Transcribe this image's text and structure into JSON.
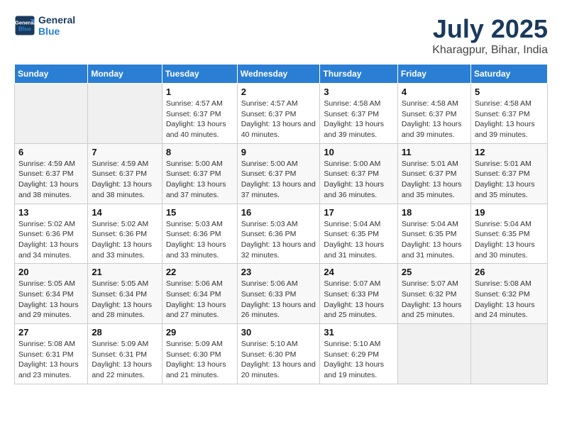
{
  "header": {
    "logo_line1": "General",
    "logo_line2": "Blue",
    "title": "July 2025",
    "subtitle": "Kharagpur, Bihar, India"
  },
  "days_of_week": [
    "Sunday",
    "Monday",
    "Tuesday",
    "Wednesday",
    "Thursday",
    "Friday",
    "Saturday"
  ],
  "weeks": [
    [
      {
        "day": "",
        "empty": true
      },
      {
        "day": "",
        "empty": true
      },
      {
        "day": "1",
        "sunrise": "4:57 AM",
        "sunset": "6:37 PM",
        "daylight": "13 hours and 40 minutes."
      },
      {
        "day": "2",
        "sunrise": "4:57 AM",
        "sunset": "6:37 PM",
        "daylight": "13 hours and 40 minutes."
      },
      {
        "day": "3",
        "sunrise": "4:58 AM",
        "sunset": "6:37 PM",
        "daylight": "13 hours and 39 minutes."
      },
      {
        "day": "4",
        "sunrise": "4:58 AM",
        "sunset": "6:37 PM",
        "daylight": "13 hours and 39 minutes."
      },
      {
        "day": "5",
        "sunrise": "4:58 AM",
        "sunset": "6:37 PM",
        "daylight": "13 hours and 39 minutes."
      }
    ],
    [
      {
        "day": "6",
        "sunrise": "4:59 AM",
        "sunset": "6:37 PM",
        "daylight": "13 hours and 38 minutes."
      },
      {
        "day": "7",
        "sunrise": "4:59 AM",
        "sunset": "6:37 PM",
        "daylight": "13 hours and 38 minutes."
      },
      {
        "day": "8",
        "sunrise": "5:00 AM",
        "sunset": "6:37 PM",
        "daylight": "13 hours and 37 minutes."
      },
      {
        "day": "9",
        "sunrise": "5:00 AM",
        "sunset": "6:37 PM",
        "daylight": "13 hours and 37 minutes."
      },
      {
        "day": "10",
        "sunrise": "5:00 AM",
        "sunset": "6:37 PM",
        "daylight": "13 hours and 36 minutes."
      },
      {
        "day": "11",
        "sunrise": "5:01 AM",
        "sunset": "6:37 PM",
        "daylight": "13 hours and 35 minutes."
      },
      {
        "day": "12",
        "sunrise": "5:01 AM",
        "sunset": "6:37 PM",
        "daylight": "13 hours and 35 minutes."
      }
    ],
    [
      {
        "day": "13",
        "sunrise": "5:02 AM",
        "sunset": "6:36 PM",
        "daylight": "13 hours and 34 minutes."
      },
      {
        "day": "14",
        "sunrise": "5:02 AM",
        "sunset": "6:36 PM",
        "daylight": "13 hours and 33 minutes."
      },
      {
        "day": "15",
        "sunrise": "5:03 AM",
        "sunset": "6:36 PM",
        "daylight": "13 hours and 33 minutes."
      },
      {
        "day": "16",
        "sunrise": "5:03 AM",
        "sunset": "6:36 PM",
        "daylight": "13 hours and 32 minutes."
      },
      {
        "day": "17",
        "sunrise": "5:04 AM",
        "sunset": "6:35 PM",
        "daylight": "13 hours and 31 minutes."
      },
      {
        "day": "18",
        "sunrise": "5:04 AM",
        "sunset": "6:35 PM",
        "daylight": "13 hours and 31 minutes."
      },
      {
        "day": "19",
        "sunrise": "5:04 AM",
        "sunset": "6:35 PM",
        "daylight": "13 hours and 30 minutes."
      }
    ],
    [
      {
        "day": "20",
        "sunrise": "5:05 AM",
        "sunset": "6:34 PM",
        "daylight": "13 hours and 29 minutes."
      },
      {
        "day": "21",
        "sunrise": "5:05 AM",
        "sunset": "6:34 PM",
        "daylight": "13 hours and 28 minutes."
      },
      {
        "day": "22",
        "sunrise": "5:06 AM",
        "sunset": "6:34 PM",
        "daylight": "13 hours and 27 minutes."
      },
      {
        "day": "23",
        "sunrise": "5:06 AM",
        "sunset": "6:33 PM",
        "daylight": "13 hours and 26 minutes."
      },
      {
        "day": "24",
        "sunrise": "5:07 AM",
        "sunset": "6:33 PM",
        "daylight": "13 hours and 25 minutes."
      },
      {
        "day": "25",
        "sunrise": "5:07 AM",
        "sunset": "6:32 PM",
        "daylight": "13 hours and 25 minutes."
      },
      {
        "day": "26",
        "sunrise": "5:08 AM",
        "sunset": "6:32 PM",
        "daylight": "13 hours and 24 minutes."
      }
    ],
    [
      {
        "day": "27",
        "sunrise": "5:08 AM",
        "sunset": "6:31 PM",
        "daylight": "13 hours and 23 minutes."
      },
      {
        "day": "28",
        "sunrise": "5:09 AM",
        "sunset": "6:31 PM",
        "daylight": "13 hours and 22 minutes."
      },
      {
        "day": "29",
        "sunrise": "5:09 AM",
        "sunset": "6:30 PM",
        "daylight": "13 hours and 21 minutes."
      },
      {
        "day": "30",
        "sunrise": "5:10 AM",
        "sunset": "6:30 PM",
        "daylight": "13 hours and 20 minutes."
      },
      {
        "day": "31",
        "sunrise": "5:10 AM",
        "sunset": "6:29 PM",
        "daylight": "13 hours and 19 minutes."
      },
      {
        "day": "",
        "empty": true
      },
      {
        "day": "",
        "empty": true
      }
    ]
  ],
  "labels": {
    "sunrise": "Sunrise:",
    "sunset": "Sunset:",
    "daylight": "Daylight:"
  }
}
